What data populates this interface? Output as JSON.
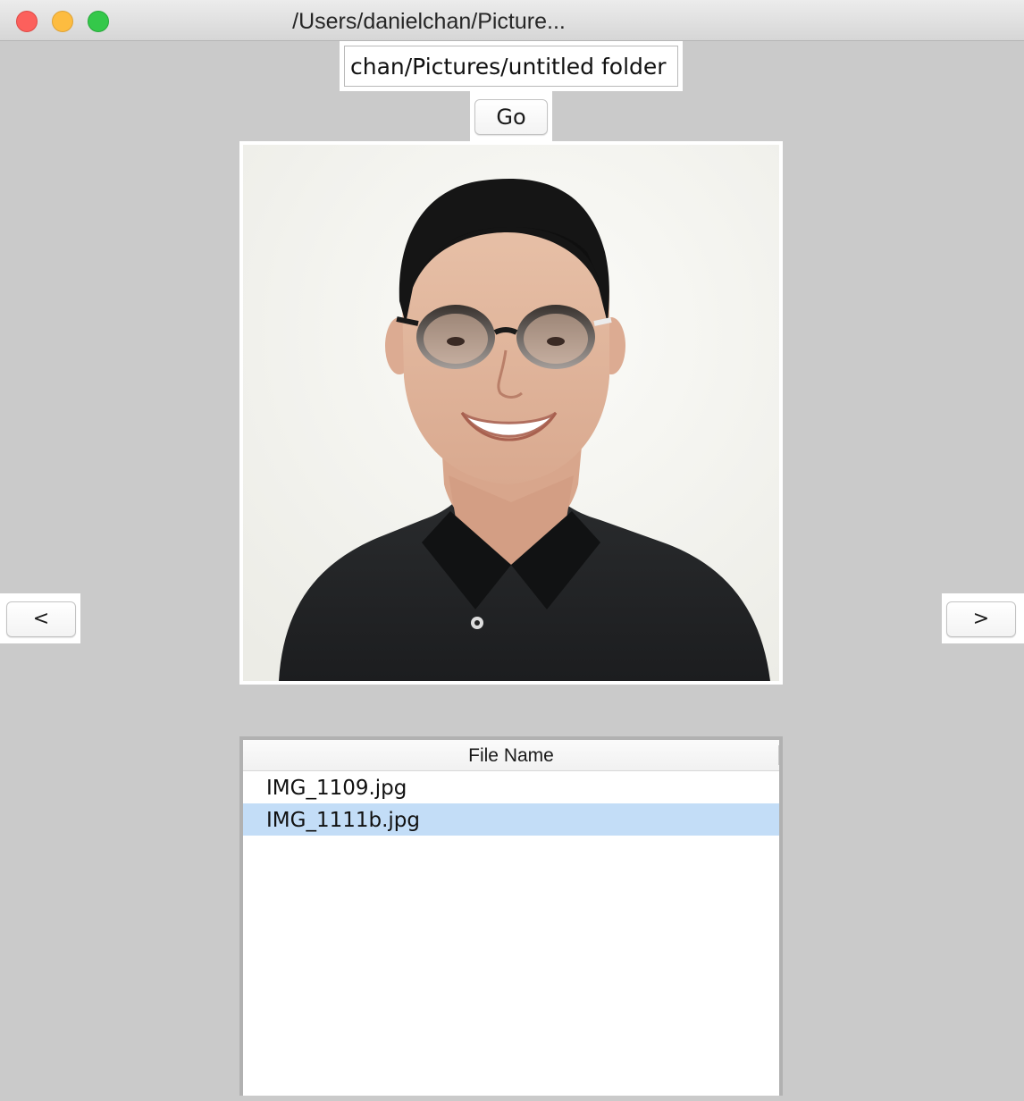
{
  "window": {
    "title": "/Users/danielchan/Picture..."
  },
  "path_field": {
    "value": "chan/Pictures/untitled folder"
  },
  "go_button": {
    "label": "Go"
  },
  "navigation": {
    "prev_label": "<",
    "next_label": ">"
  },
  "file_table": {
    "column_header": "File Name",
    "rows": [
      {
        "name": "IMG_1109.jpg",
        "selected": false
      },
      {
        "name": "IMG_1111b.jpg",
        "selected": true
      }
    ]
  },
  "colors": {
    "selection": "#c3ddf7",
    "close_light": "#fc605c",
    "minimize_light": "#fdbc40",
    "zoom_light": "#34c84a"
  }
}
